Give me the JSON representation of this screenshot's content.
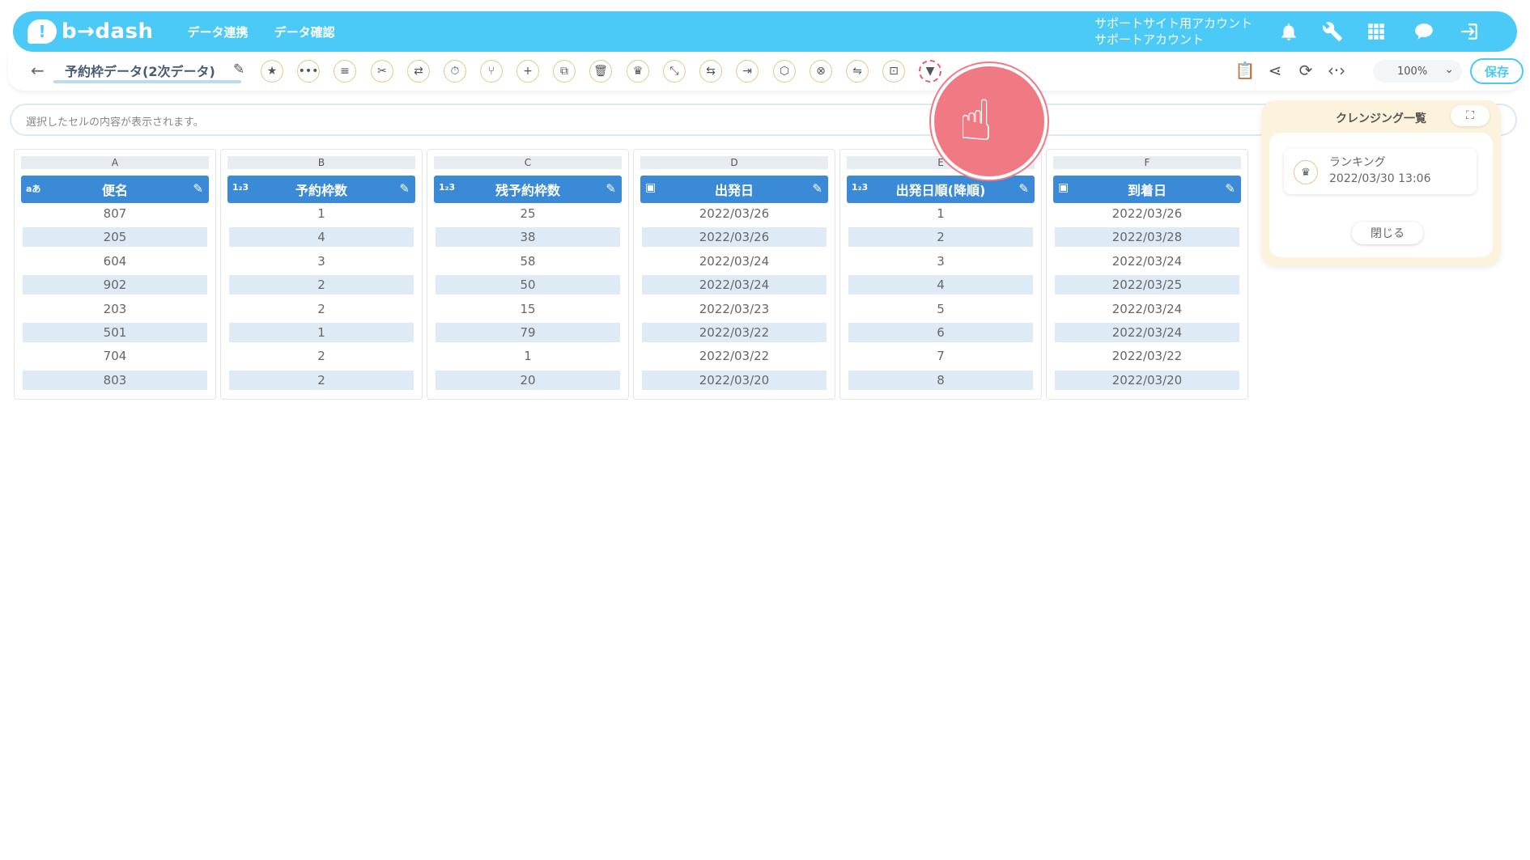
{
  "header": {
    "logo_text": "b→dash",
    "nav": [
      "データ連携",
      "データ確認"
    ],
    "account_line1": "サポートサイト用アカウント",
    "account_line2": "サポートアカウント",
    "icons": [
      "bell-icon",
      "wrench-icon",
      "grid-icon",
      "bird-icon",
      "logout-icon"
    ]
  },
  "toolbar": {
    "back": "←",
    "title": "予約枠データ(2次データ)",
    "tools": [
      "★",
      "•••",
      "≡",
      "✂",
      "⇄",
      "⏱",
      "⑂",
      "+",
      "⧉",
      "🗑",
      "♛",
      "⤡",
      "⇆",
      "⇥",
      "⬡",
      "⊗",
      "⇋",
      "⊡",
      "▼"
    ],
    "zoom": "100%",
    "save_label": "保存"
  },
  "formula_bar": {
    "placeholder": "選択したセルの内容が表示されます。"
  },
  "columns": [
    {
      "letter": "A",
      "type": "aあ",
      "name": "便名",
      "cells": [
        "807",
        "205",
        "604",
        "902",
        "203",
        "501",
        "704",
        "803"
      ]
    },
    {
      "letter": "B",
      "type": "1₂3",
      "name": "予約枠数",
      "cells": [
        "1",
        "4",
        "3",
        "2",
        "2",
        "1",
        "2",
        "2"
      ]
    },
    {
      "letter": "C",
      "type": "1₂3",
      "name": "残予約枠数",
      "cells": [
        "25",
        "38",
        "58",
        "50",
        "15",
        "79",
        "1",
        "20"
      ]
    },
    {
      "letter": "D",
      "type": "cal",
      "name": "出発日",
      "cells": [
        "2022/03/26",
        "2022/03/26",
        "2022/03/24",
        "2022/03/24",
        "2022/03/23",
        "2022/03/22",
        "2022/03/22",
        "2022/03/20"
      ]
    },
    {
      "letter": "E",
      "type": "1₂3",
      "name": "出発日順(降順)",
      "cells": [
        "1",
        "2",
        "3",
        "4",
        "5",
        "6",
        "7",
        "8"
      ]
    },
    {
      "letter": "F",
      "type": "cal",
      "name": "到着日",
      "cells": [
        "2022/03/26",
        "2022/03/28",
        "2022/03/24",
        "2022/03/25",
        "2022/03/24",
        "2022/03/24",
        "2022/03/22",
        "2022/03/20"
      ]
    }
  ],
  "panel": {
    "title": "クレンジング一覧",
    "item_label": "ランキング",
    "item_date": "2022/03/30 13:06",
    "close_label": "閉じる"
  }
}
